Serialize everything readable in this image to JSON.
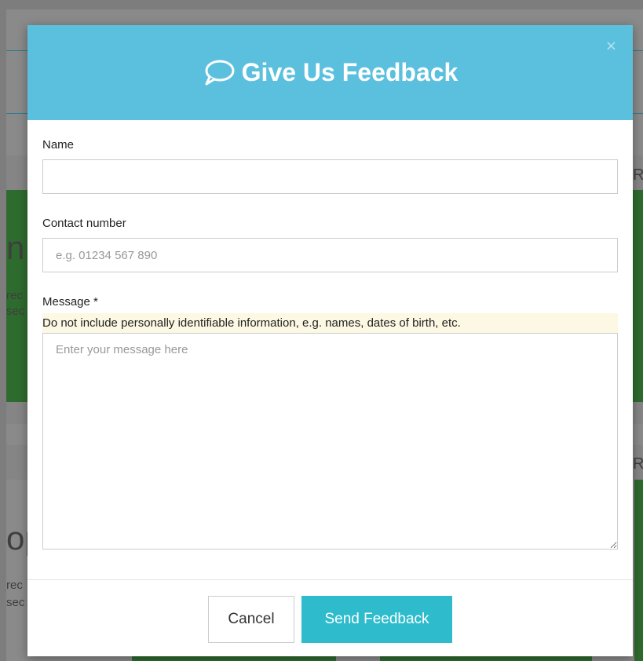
{
  "background": {
    "fragments": [
      {
        "text": "n"
      },
      {
        "text": "rec"
      },
      {
        "text": "sec"
      },
      {
        "text": "op"
      },
      {
        "text": "rec"
      },
      {
        "text": "sec"
      },
      {
        "text": "R("
      },
      {
        "text": "R("
      }
    ]
  },
  "modal": {
    "title": "Give Us Feedback",
    "title_icon": "speech-bubble-icon",
    "close_label": "×",
    "header_color": "#5bc0de",
    "fields": {
      "name": {
        "label": "Name",
        "value": "",
        "placeholder": ""
      },
      "contact": {
        "label": "Contact number",
        "value": "",
        "placeholder": "e.g. 01234 567 890"
      },
      "message": {
        "label": "Message *",
        "help": "Do not include personally identifiable information, e.g. names, dates of birth, etc.",
        "value": "",
        "placeholder": "Enter your message here"
      }
    },
    "buttons": {
      "cancel": "Cancel",
      "send": "Send Feedback"
    },
    "accent_color": "#2ebccd"
  }
}
